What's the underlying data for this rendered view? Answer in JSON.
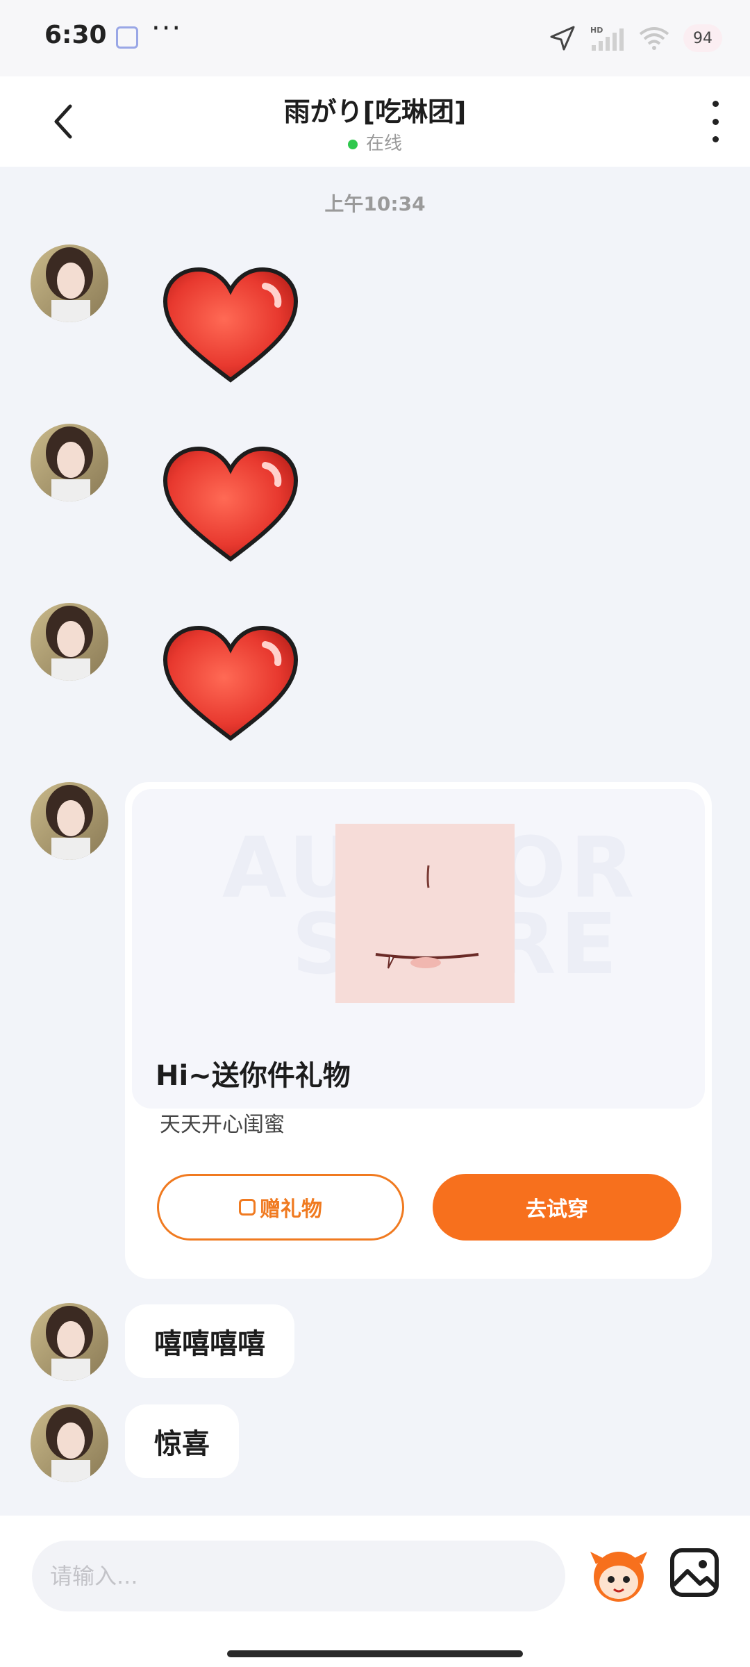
{
  "status_bar": {
    "time": "6:30",
    "more": "···",
    "battery": "94"
  },
  "header": {
    "title": "雨がり[吃琳团]",
    "status": "在线"
  },
  "chat": {
    "timestamp": "上午10:34",
    "gift_card": {
      "watermark_line1": "AUTHOR",
      "watermark_line2": "STORE",
      "title": "Hi~送你件礼物",
      "subtitle": "天天开心闺蜜",
      "give_button": "赠礼物",
      "try_button": "去试穿"
    },
    "text_messages": [
      "嘻嘻嘻嘻",
      "惊喜"
    ]
  },
  "input": {
    "placeholder": "请输入..."
  },
  "colors": {
    "accent": "#f7701d",
    "online": "#2fc84d",
    "heart": "#e8392f"
  },
  "icons": [
    "back-arrow-icon",
    "more-vertical-icon",
    "location-icon",
    "signal-icon",
    "wifi-icon",
    "heart-sticker-icon",
    "gift-icon",
    "mascot-sticker-icon",
    "image-icon"
  ]
}
